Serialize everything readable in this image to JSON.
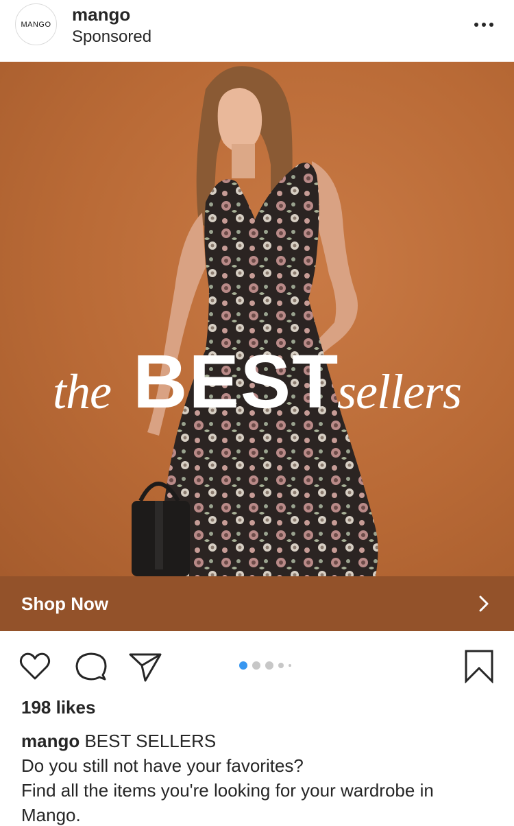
{
  "header": {
    "avatar_text": "MANGO",
    "username": "mango",
    "sponsored": "Sponsored"
  },
  "ad": {
    "headline_the": "the",
    "headline_best": "BEST",
    "headline_sellers": "sellers",
    "background_color": "#b96a36"
  },
  "cta": {
    "label": "Shop Now",
    "background_color": "#93522a"
  },
  "actions": {
    "like_icon": "heart-icon",
    "comment_icon": "comment-icon",
    "share_icon": "send-icon",
    "save_icon": "bookmark-icon"
  },
  "carousel": {
    "count": 5,
    "active_index": 0,
    "active_color": "#3897f0"
  },
  "post": {
    "likes": "198 likes",
    "caption_user": "mango",
    "caption_title": "BEST SELLERS",
    "caption_line1": "Do you still not have your favorites?",
    "caption_line2": "Find all the items you're looking for your wardrobe in Mango."
  }
}
